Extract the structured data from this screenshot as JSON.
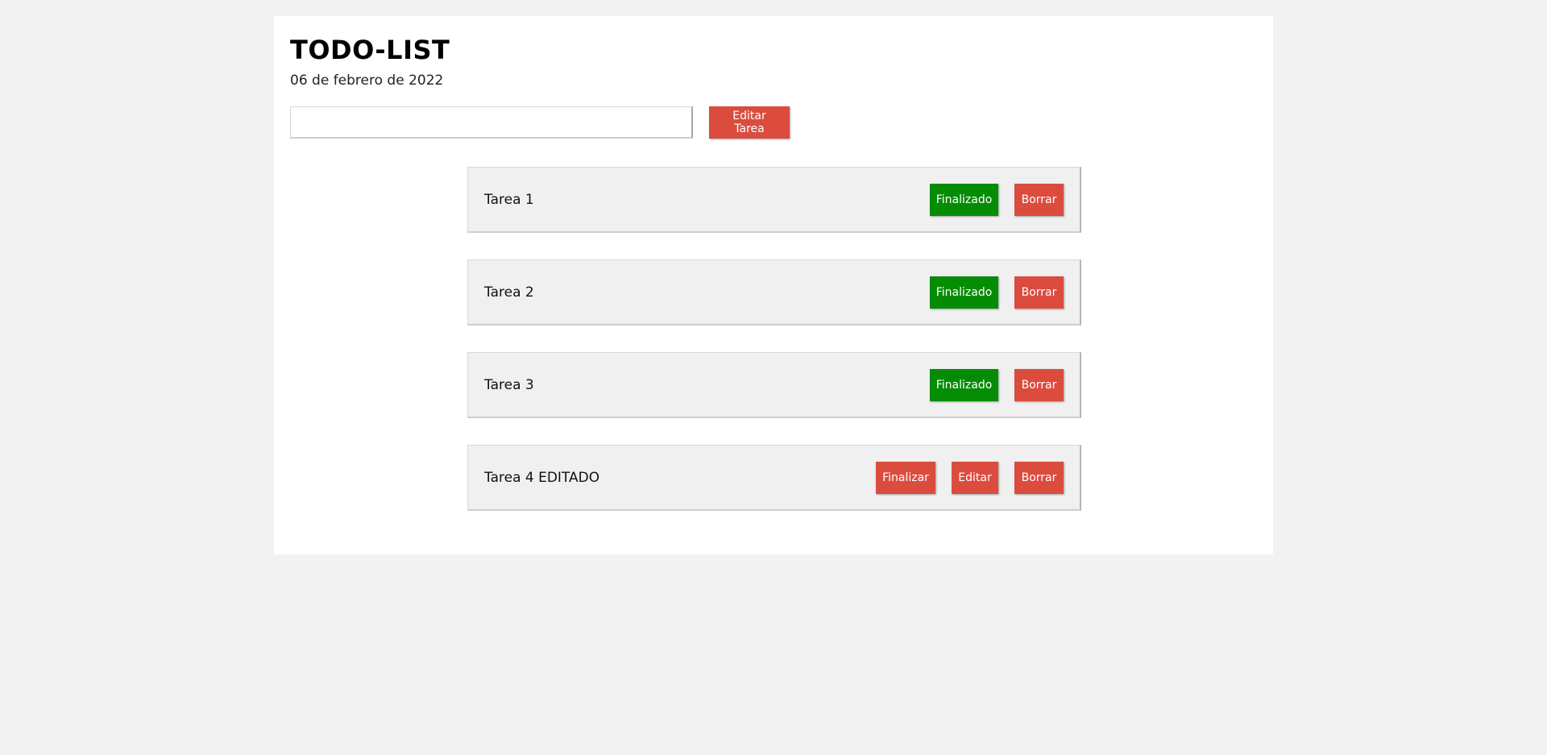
{
  "header": {
    "title": "TODO-LIST",
    "date": "06 de febrero de 2022"
  },
  "form": {
    "input_value": "",
    "submit_label": "Editar Tarea"
  },
  "tasks": [
    {
      "name": "Tarea 1",
      "status": "done",
      "finish_label": "Finalizado",
      "delete_label": "Borrar"
    },
    {
      "name": "Tarea 2",
      "status": "done",
      "finish_label": "Finalizado",
      "delete_label": "Borrar"
    },
    {
      "name": "Tarea 3",
      "status": "done",
      "finish_label": "Finalizado",
      "delete_label": "Borrar"
    },
    {
      "name": "Tarea 4 EDITADO",
      "status": "pending",
      "finish_label": "Finalizar",
      "edit_label": "Editar",
      "delete_label": "Borrar"
    }
  ],
  "colors": {
    "background": "#f2f2f2",
    "card": "#ffffff",
    "task_bg": "#f0f0f0",
    "danger": "#db4c3f",
    "success": "#058c05"
  }
}
